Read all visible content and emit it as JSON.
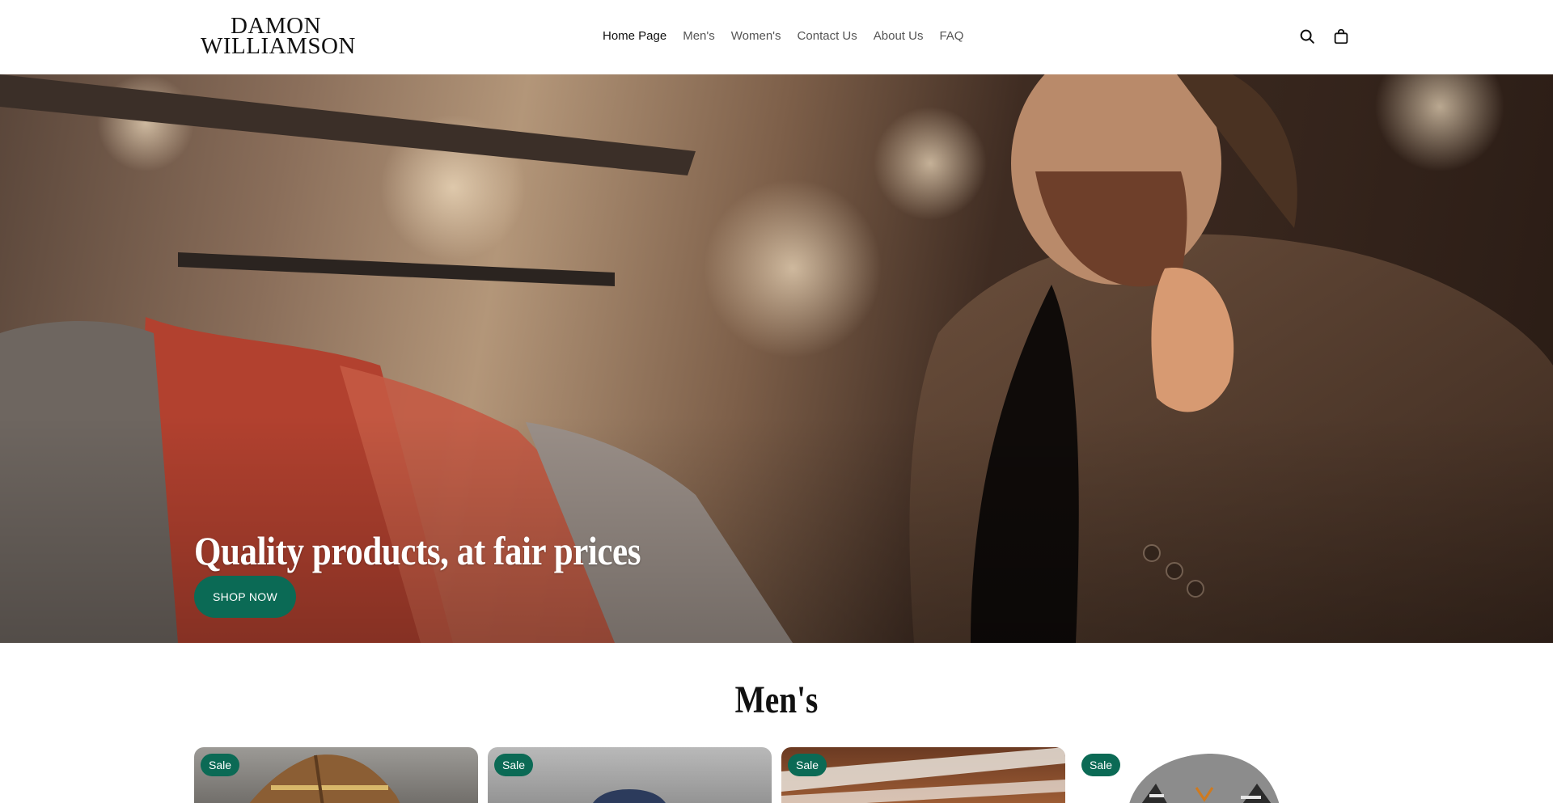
{
  "header": {
    "logo": {
      "line1": "DAMON",
      "line2": "WILLIAMSON"
    },
    "nav": [
      {
        "label": "Home Page",
        "active": true
      },
      {
        "label": "Men's",
        "active": false
      },
      {
        "label": "Women's",
        "active": false
      },
      {
        "label": "Contact Us",
        "active": false
      },
      {
        "label": "About Us",
        "active": false
      },
      {
        "label": "FAQ",
        "active": false
      }
    ],
    "icons": [
      "search-icon",
      "cart-icon"
    ]
  },
  "hero": {
    "headline": "Quality products, at fair prices",
    "button_label": "SHOP NOW"
  },
  "section": {
    "title": "Men's"
  },
  "products": [
    {
      "badge": "Sale"
    },
    {
      "badge": "Sale"
    },
    {
      "badge": "Sale"
    },
    {
      "badge": "Sale"
    }
  ],
  "colors": {
    "accent": "#0b6a55",
    "text": "#111111",
    "nav_text": "#555555",
    "background": "#ffffff"
  }
}
